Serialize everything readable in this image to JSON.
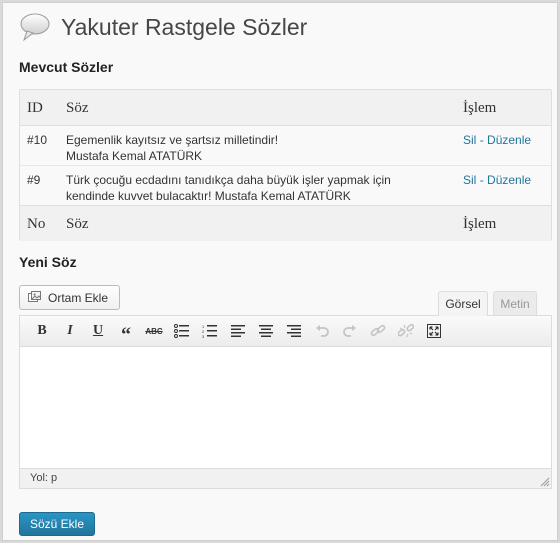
{
  "header": {
    "title": "Yakuter Rastgele Sözler",
    "icon": "speech-bubble-icon"
  },
  "existing": {
    "section_title": "Mevcut Sözler",
    "columns": {
      "id": "ID",
      "quote": "Söz",
      "action": "İşlem"
    },
    "footer": {
      "id": "No",
      "quote": "Söz",
      "action": "İşlem"
    },
    "rows": [
      {
        "id": "#10",
        "line1": "Egemenlik kayıtsız ve şartsız milletindir!",
        "line2": "Mustafa Kemal ATATÜRK",
        "delete": "Sil",
        "sep": "-",
        "edit": "Düzenle"
      },
      {
        "id": "#9",
        "line1": "Türk çocuğu ecdadını tanıdıkça daha büyük işler yapmak için",
        "line2": "kendinde kuvvet bulacaktır! Mustafa Kemal ATATÜRK",
        "delete": "Sil",
        "sep": "-",
        "edit": "Düzenle"
      }
    ]
  },
  "new_quote": {
    "section_title": "Yeni Söz",
    "media_button": "Ortam Ekle",
    "tabs": {
      "visual": "Görsel",
      "text": "Metin"
    },
    "toolbar": {
      "bold": "B",
      "italic": "I",
      "underline": "U",
      "quote": "“",
      "strike": "ABC",
      "icons": [
        "bold-icon",
        "italic-icon",
        "underline-icon",
        "blockquote-icon",
        "strikethrough-icon",
        "bullet-list-icon",
        "numbered-list-icon",
        "align-left-icon",
        "align-center-icon",
        "align-right-icon",
        "undo-icon",
        "redo-icon",
        "link-icon",
        "unlink-icon",
        "fullscreen-icon"
      ]
    },
    "editor_content": "",
    "path_label": "Yol: p",
    "submit": "Sözü Ekle"
  },
  "colors": {
    "link": "#21759b",
    "button_primary": "#21759b"
  }
}
